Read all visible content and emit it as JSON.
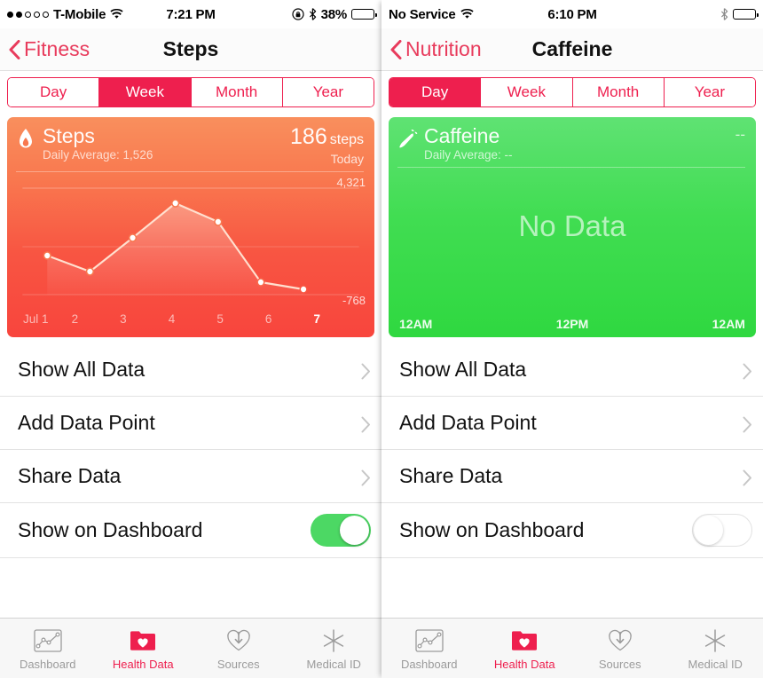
{
  "panes": [
    {
      "status": {
        "signal_dots_filled": 2,
        "signal_dots_total": 5,
        "carrier": "T-Mobile",
        "wifi_icon": "wifi-icon",
        "time": "7:21 PM",
        "lock_icon": "rotation-lock-icon",
        "bluetooth_icon": "bluetooth-icon",
        "battery_percent": "38%",
        "battery_level": 38
      },
      "nav": {
        "back_label": "Fitness",
        "title": "Steps",
        "back_icon": "chevron-left-icon"
      },
      "segments": [
        {
          "label": "Day",
          "active": false
        },
        {
          "label": "Week",
          "active": true
        },
        {
          "label": "Month",
          "active": false
        },
        {
          "label": "Year",
          "active": false
        }
      ],
      "card": {
        "icon": "flame-icon",
        "title": "Steps",
        "subtitle": "Daily Average: 1,526",
        "value": "186",
        "unit": "steps",
        "when": "Today",
        "accent": "#f8483f",
        "has_data": true
      },
      "rows": [
        {
          "label": "Show All Data",
          "type": "disclosure",
          "icon": "chevron-right-icon"
        },
        {
          "label": "Add Data Point",
          "type": "disclosure",
          "icon": "chevron-right-icon"
        },
        {
          "label": "Share Data",
          "type": "disclosure",
          "icon": "chevron-right-icon"
        },
        {
          "label": "Show on Dashboard",
          "type": "switch",
          "value": true
        }
      ],
      "tabs": [
        {
          "label": "Dashboard",
          "icon": "dashboard-chart-icon",
          "active": false
        },
        {
          "label": "Health Data",
          "icon": "folder-heart-icon",
          "active": true
        },
        {
          "label": "Sources",
          "icon": "heart-download-icon",
          "active": false
        },
        {
          "label": "Medical ID",
          "icon": "medical-asterisk-icon",
          "active": false
        }
      ]
    },
    {
      "status": {
        "signal_dots_filled": 0,
        "signal_dots_total": 0,
        "carrier": "No Service",
        "wifi_icon": "wifi-icon",
        "time": "6:10 PM",
        "lock_icon": null,
        "bluetooth_icon": "bluetooth-icon",
        "battery_percent": "",
        "battery_level": 100
      },
      "nav": {
        "back_label": "Nutrition",
        "title": "Caffeine",
        "back_icon": "chevron-left-icon"
      },
      "segments": [
        {
          "label": "Day",
          "active": true
        },
        {
          "label": "Week",
          "active": false
        },
        {
          "label": "Month",
          "active": false
        },
        {
          "label": "Year",
          "active": false
        }
      ],
      "card": {
        "icon": "carrot-icon",
        "title": "Caffeine",
        "subtitle": "Daily Average: --",
        "value": "--",
        "unit": "",
        "when": "",
        "accent": "#33d944",
        "has_data": false,
        "empty_text": "No Data"
      },
      "rows": [
        {
          "label": "Show All Data",
          "type": "disclosure",
          "icon": "chevron-right-icon"
        },
        {
          "label": "Add Data Point",
          "type": "disclosure",
          "icon": "chevron-right-icon"
        },
        {
          "label": "Share Data",
          "type": "disclosure",
          "icon": "chevron-right-icon"
        },
        {
          "label": "Show on Dashboard",
          "type": "switch",
          "value": false
        }
      ],
      "tabs": [
        {
          "label": "Dashboard",
          "icon": "dashboard-chart-icon",
          "active": false
        },
        {
          "label": "Health Data",
          "icon": "folder-heart-icon",
          "active": true
        },
        {
          "label": "Sources",
          "icon": "heart-download-icon",
          "active": false
        },
        {
          "label": "Medical ID",
          "icon": "medical-asterisk-icon",
          "active": false
        }
      ]
    }
  ],
  "chart_data": [
    {
      "type": "line",
      "title": "Steps",
      "subtitle": "Daily Average: 1,526",
      "categories": [
        "Jul 1",
        "2",
        "3",
        "4",
        "5",
        "6",
        "7"
      ],
      "values": [
        1600,
        1180,
        2150,
        3750,
        3000,
        620,
        186
      ],
      "ylim": [
        -768,
        4321
      ],
      "ytick_labels": [
        "4,321",
        "-768"
      ],
      "xlabel": "",
      "ylabel": "",
      "grid": false,
      "legend": "none",
      "highlight_index": 6,
      "line_color": "#ffe3d4",
      "fill": "linear-gradient",
      "marker": "open-circle"
    },
    {
      "type": "line",
      "title": "Caffeine",
      "subtitle": "Daily Average: --",
      "categories": [
        "12AM",
        "12PM",
        "12AM"
      ],
      "values": [],
      "annotation": "No Data",
      "xlabel": "",
      "ylabel": "",
      "grid": false,
      "legend": "none"
    }
  ]
}
